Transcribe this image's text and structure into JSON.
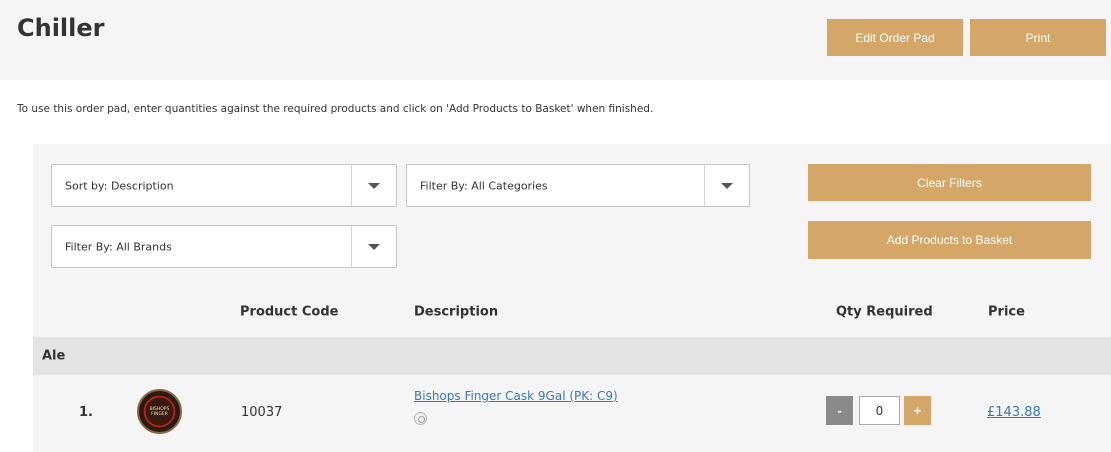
{
  "page": {
    "title": "Chiller"
  },
  "header": {
    "edit_order_pad_label": "Edit Order Pad",
    "print_label": "Print"
  },
  "intro_text": "To use this order pad, enter quantities against the required products and click on 'Add Products to Basket' when finished.",
  "filters": {
    "sort_by": "Sort by: Description",
    "categories": "Filter By: All Categories",
    "brands": "Filter By: All Brands",
    "clear_label": "Clear Filters",
    "add_to_basket_label": "Add Products to Basket"
  },
  "table": {
    "columns": {
      "product_code": "Product Code",
      "description": "Description",
      "qty_required": "Qty Required",
      "price": "Price"
    },
    "groups": [
      {
        "name": "Ale",
        "rows": [
          {
            "index": "1.",
            "thumb_text_line1": "BISHOPS",
            "thumb_text_line2": "FINGER",
            "code": "10037",
            "description": "Bishops Finger Cask 9Gal (PK: C9)",
            "qty": "0",
            "minus_label": "-",
            "plus_label": "+",
            "price": "£143.88"
          }
        ]
      }
    ]
  },
  "colors": {
    "accent": "#d4a769",
    "link": "#3a78b5",
    "panel": "#f5f5f5",
    "group": "#e4e4e4"
  }
}
